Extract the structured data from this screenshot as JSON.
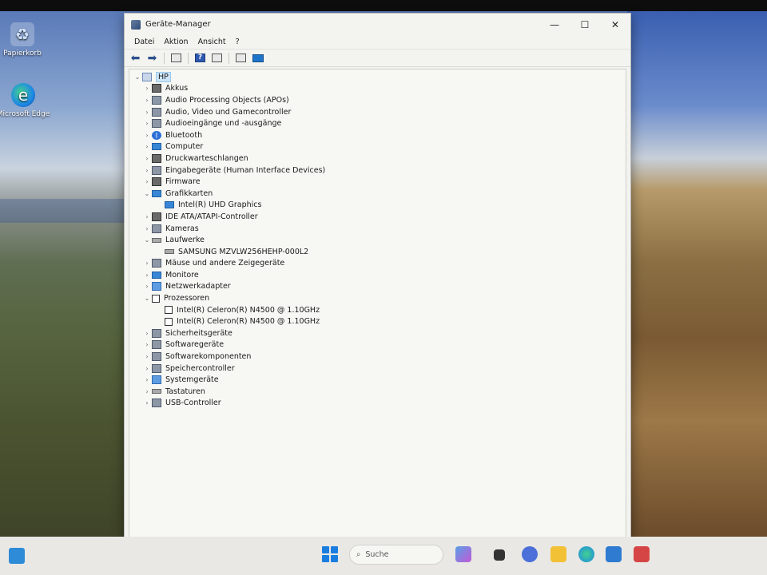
{
  "desktop": {
    "icons": [
      {
        "label": "Papierkorb",
        "icon": "recycle-bin-icon"
      },
      {
        "label": "Microsoft Edge",
        "icon": "edge-icon"
      }
    ]
  },
  "window": {
    "title": "Geräte-Manager",
    "controls": {
      "minimize": "—",
      "maximize": "☐",
      "close": "✕"
    }
  },
  "menu": [
    "Datei",
    "Aktion",
    "Ansicht",
    "?"
  ],
  "toolbar": {
    "back": "back-arrow-icon",
    "forward": "forward-arrow-icon",
    "properties": "properties-icon",
    "help": "help-icon",
    "view": "view-icon",
    "update": "update-driver-icon",
    "scan": "scan-monitor-icon"
  },
  "tree": {
    "root": "HP",
    "nodes": [
      {
        "label": "Akkus",
        "expanded": false,
        "icon": "battery-icon"
      },
      {
        "label": "Audio Processing Objects (APOs)",
        "expanded": false,
        "icon": "audio-icon"
      },
      {
        "label": "Audio, Video und Gamecontroller",
        "expanded": false,
        "icon": "audio-icon"
      },
      {
        "label": "Audioeingänge und -ausgänge",
        "expanded": false,
        "icon": "audio-icon"
      },
      {
        "label": "Bluetooth",
        "expanded": false,
        "icon": "bluetooth-icon"
      },
      {
        "label": "Computer",
        "expanded": false,
        "icon": "computer-icon"
      },
      {
        "label": "Druckwarteschlangen",
        "expanded": false,
        "icon": "printer-icon"
      },
      {
        "label": "Eingabegeräte (Human Interface Devices)",
        "expanded": false,
        "icon": "hid-icon"
      },
      {
        "label": "Firmware",
        "expanded": false,
        "icon": "firmware-icon"
      },
      {
        "label": "Grafikkarten",
        "expanded": true,
        "icon": "display-adapter-icon",
        "children": [
          "Intel(R) UHD Graphics"
        ]
      },
      {
        "label": "IDE ATA/ATAPI-Controller",
        "expanded": false,
        "icon": "ide-icon"
      },
      {
        "label": "Kameras",
        "expanded": false,
        "icon": "camera-icon"
      },
      {
        "label": "Laufwerke",
        "expanded": true,
        "icon": "drive-icon",
        "children": [
          "SAMSUNG MZVLW256HEHP-000L2"
        ]
      },
      {
        "label": "Mäuse und andere Zeigegeräte",
        "expanded": false,
        "icon": "mouse-icon"
      },
      {
        "label": "Monitore",
        "expanded": false,
        "icon": "monitor-icon"
      },
      {
        "label": "Netzwerkadapter",
        "expanded": false,
        "icon": "network-icon"
      },
      {
        "label": "Prozessoren",
        "expanded": true,
        "icon": "processor-icon",
        "children": [
          "Intel(R) Celeron(R) N4500 @ 1.10GHz",
          "Intel(R) Celeron(R) N4500 @ 1.10GHz"
        ]
      },
      {
        "label": "Sicherheitsgeräte",
        "expanded": false,
        "icon": "security-icon"
      },
      {
        "label": "Softwaregeräte",
        "expanded": false,
        "icon": "software-device-icon"
      },
      {
        "label": "Softwarekomponenten",
        "expanded": false,
        "icon": "software-component-icon"
      },
      {
        "label": "Speichercontroller",
        "expanded": false,
        "icon": "storage-controller-icon"
      },
      {
        "label": "Systemgeräte",
        "expanded": false,
        "icon": "system-device-icon"
      },
      {
        "label": "Tastaturen",
        "expanded": false,
        "icon": "keyboard-icon"
      },
      {
        "label": "USB-Controller",
        "expanded": false,
        "icon": "usb-icon"
      }
    ]
  },
  "taskbar": {
    "search_label": "Suche",
    "apps": [
      "copilot-icon",
      "task-view-icon",
      "chat-icon",
      "file-explorer-icon",
      "edge-icon",
      "store-icon",
      "app-icon"
    ]
  }
}
